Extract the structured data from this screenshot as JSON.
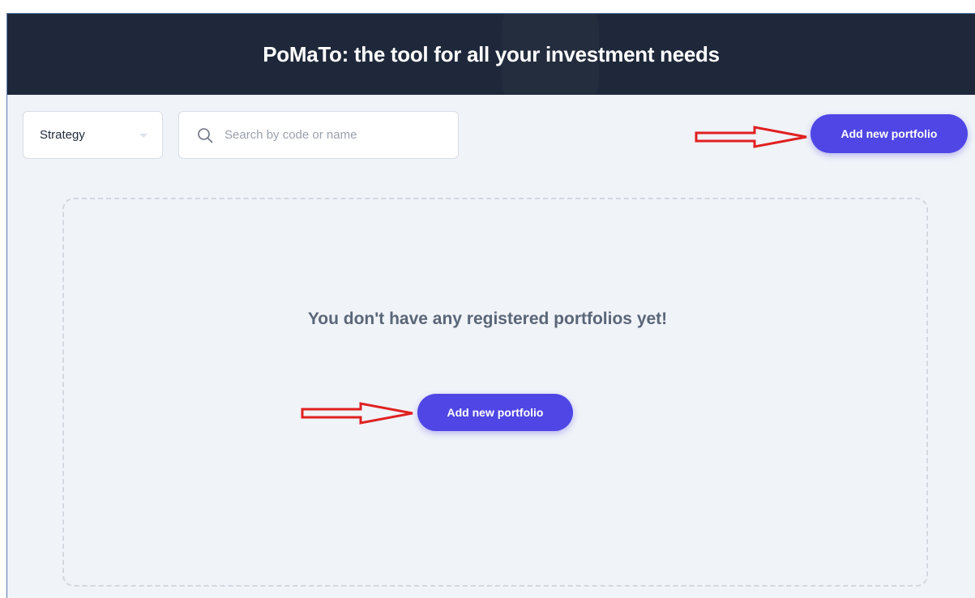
{
  "header": {
    "title": "PoMaTo: the tool for all your investment needs"
  },
  "toolbar": {
    "strategy_label": "Strategy",
    "search_placeholder": "Search by code or name",
    "add_button_label": "Add new portfolio"
  },
  "empty_state": {
    "message": "You don't have any registered portfolios yet!",
    "add_button_label": "Add new portfolio"
  },
  "colors": {
    "header_bg": "#1e283a",
    "page_bg": "#f0f3f8",
    "accent": "#4f46e5",
    "annotation_arrow": "#e02020"
  },
  "icons": [
    "search-icon",
    "chevron-down-icon",
    "arrow-right-icon"
  ]
}
